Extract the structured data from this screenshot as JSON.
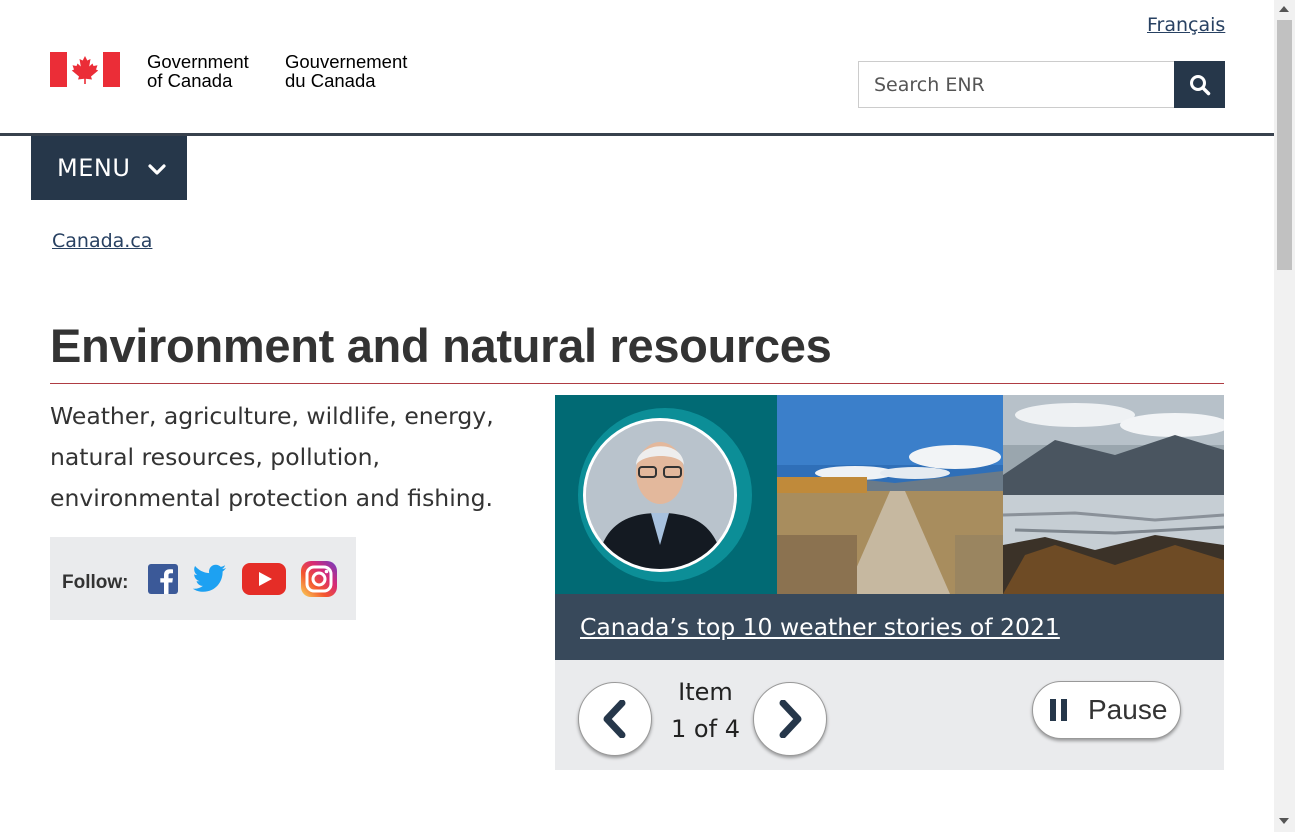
{
  "header": {
    "lang_link": "Français",
    "signature_en_line1": "Government",
    "signature_en_line2": "of Canada",
    "signature_fr_line1": "Gouvernement",
    "signature_fr_line2": "du Canada",
    "search_placeholder": "Search ENR",
    "search_icon": "search-icon"
  },
  "menu": {
    "label": "MENU",
    "icon": "chevron-down-icon"
  },
  "breadcrumb": {
    "items": [
      "Canada.ca"
    ]
  },
  "main": {
    "title": "Environment and natural resources",
    "intro": "Weather, agriculture, wildlife, energy, natural resources, pollution, environmental protection and fishing.",
    "follow": {
      "label": "Follow:",
      "icons": [
        "facebook-icon",
        "twitter-icon",
        "youtube-icon",
        "instagram-icon"
      ]
    }
  },
  "carousel": {
    "caption": "Canada’s top 10 weather stories of 2021",
    "item_label": "Item",
    "item_count": "1 of 4",
    "pause_label": "Pause",
    "icons": [
      "chevron-left-icon",
      "chevron-right-icon",
      "pause-icon"
    ]
  },
  "colors": {
    "brand_dark": "#26374a",
    "link": "#284162",
    "title_rule": "#af3c43",
    "flag_red": "#eb2d37",
    "caption_bg": "#38495b",
    "panel_bg": "#eaebed"
  }
}
